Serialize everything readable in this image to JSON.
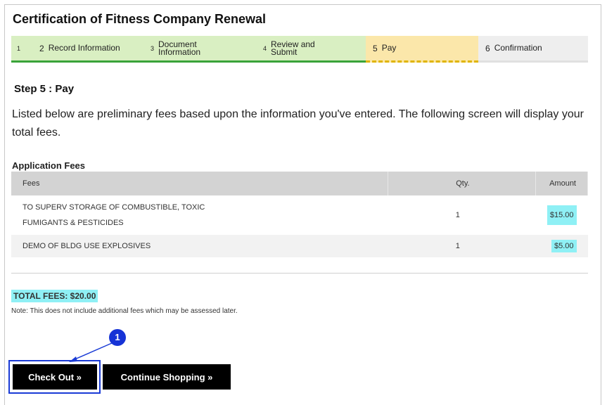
{
  "page": {
    "title": "Certification of Fitness Company Renewal",
    "steps": [
      {
        "num": "1",
        "label": ""
      },
      {
        "num": "2",
        "label": "Record Information"
      },
      {
        "num": "3",
        "label": "Document Information"
      },
      {
        "num": "4",
        "label": "Review and Submit"
      },
      {
        "num": "5",
        "label": "Pay"
      },
      {
        "num": "6",
        "label": "Confirmation"
      }
    ],
    "step_heading": "Step 5 : Pay",
    "intro": "Listed below are preliminary fees based upon the information you've entered. The following screen will display your total fees."
  },
  "fees": {
    "heading": "Application Fees",
    "columns": {
      "fees": "Fees",
      "qty": "Qty.",
      "amount": "Amount"
    },
    "rows": [
      {
        "description": "TO SUPERV STORAGE OF COMBUSTIBLE, TOXIC FUMIGANTS & PESTICIDES",
        "qty": "1",
        "amount": "$15.00"
      },
      {
        "description": "DEMO OF BLDG USE EXPLOSIVES",
        "qty": "1",
        "amount": "$5.00"
      }
    ],
    "total": "TOTAL FEES: $20.00",
    "note": "Note: This does not include additional fees which may be assessed later."
  },
  "actions": {
    "checkout_label": "Check Out »",
    "continue_label": "Continue Shopping »"
  },
  "annotation": {
    "callout_number": "1"
  },
  "colors": {
    "step_done": "#d9efc2",
    "step_current": "#fbe7aa",
    "highlight": "#8ff0f5",
    "callout": "#1633d6"
  }
}
